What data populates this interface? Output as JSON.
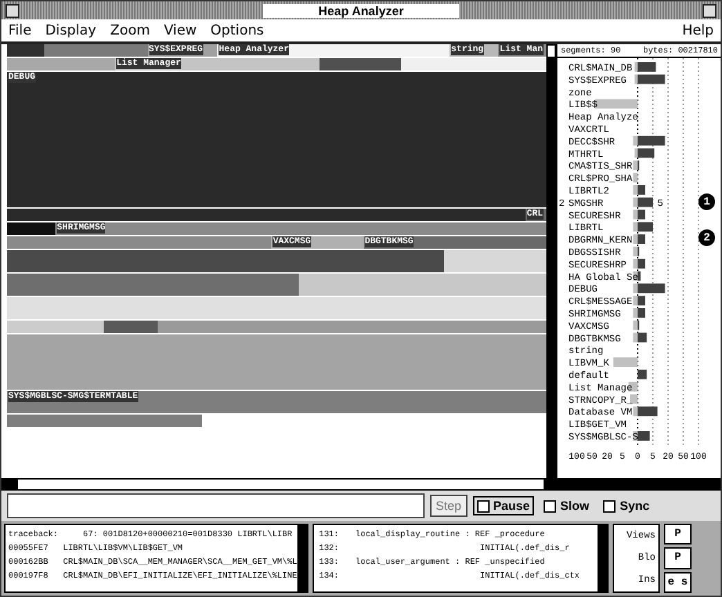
{
  "window": {
    "title": "Heap Analyzer"
  },
  "menu": {
    "left": [
      "File",
      "Display",
      "Zoom",
      "View",
      "Options"
    ],
    "right": "Help"
  },
  "memory_map": {
    "rows": [
      {
        "kind": "thin",
        "segments": [
          {
            "color": "#303030"
          },
          {
            "color": "#7a7a7a"
          },
          {
            "label": "SYS$EXPREG",
            "color": "#a0a0a0"
          },
          {
            "label": "Heap Analyzer",
            "color": "#f4f4f4"
          },
          {
            "label": "string",
            "color": "#b8b8b8"
          },
          {
            "label": "List Man",
            "color": "#8a8a8a"
          }
        ]
      },
      {
        "kind": "thin",
        "segments": [
          {
            "color": "#a8a8a8"
          },
          {
            "label": "List Manager",
            "color": "#c4c4c4"
          },
          {
            "color": "#505050"
          },
          {
            "color": "#f0f0f0"
          }
        ]
      },
      {
        "kind": "huge",
        "segments": [
          {
            "label": "DEBUG",
            "color": "#2a2a2a"
          }
        ]
      },
      {
        "kind": "thin",
        "segments": [
          {
            "color": "#2a2a2a"
          },
          {
            "label": "CRL",
            "color": "#6a6a6a"
          }
        ]
      },
      {
        "kind": "thin",
        "segments": [
          {
            "color": "#101010"
          },
          {
            "label": "SHRIMGMSG",
            "color": "#8a8a8a"
          }
        ]
      },
      {
        "kind": "thin",
        "segments": [
          {
            "color": "#8a8a8a"
          },
          {
            "label": "VAXCMSG",
            "color": "#b0b0b0"
          },
          {
            "label": "DBGTBKMSG",
            "color": "#6a6a6a"
          }
        ]
      },
      {
        "kind": "mid",
        "segments": [
          {
            "color": "#4a4a4a"
          },
          {
            "color": "#d8d8d8"
          }
        ]
      },
      {
        "kind": "mid",
        "segments": [
          {
            "color": "#6e6e6e"
          },
          {
            "color": "#c8c8c8"
          }
        ]
      },
      {
        "kind": "mid",
        "segments": [
          {
            "color": "#e0e0e0"
          }
        ]
      },
      {
        "kind": "thin",
        "segments": [
          {
            "color": "#cccccc"
          },
          {
            "color": "#5a5a5a"
          },
          {
            "color": "#9a9a9a"
          }
        ]
      },
      {
        "kind": "big",
        "segments": [
          {
            "color": "#a4a4a4"
          }
        ]
      },
      {
        "kind": "mid",
        "segments": [
          {
            "label": "SYS$MGBLSC-SMG$TERMTABLE",
            "color": "#7e7e7e"
          }
        ]
      },
      {
        "kind": "thin",
        "segments": [
          {
            "color": "#7e7e7e"
          },
          {
            "color": "#ffffff"
          }
        ]
      }
    ]
  },
  "segments_panel": {
    "segments": "segments: 90",
    "bytes": "bytes: 00217810",
    "callouts": [
      "1",
      "2"
    ],
    "items": [
      {
        "name": "CRL$MAIN_DB"
      },
      {
        "name": "SYS$EXPREG"
      },
      {
        "name": "zone"
      },
      {
        "name": "LIB$$"
      },
      {
        "name": "Heap Analyze"
      },
      {
        "name": "VAXCRTL"
      },
      {
        "name": "DECC$SHR"
      },
      {
        "name": "MTHRTL"
      },
      {
        "name": "CMA$TIS_SHR"
      },
      {
        "name": "CRL$PRO_SHA"
      },
      {
        "name": "LIBRTL2"
      },
      {
        "name": "SMGSHR",
        "left_mark": "2",
        "right_mark": "5"
      },
      {
        "name": "SECURESHR"
      },
      {
        "name": "LIBRTL"
      },
      {
        "name": "DBGRMN_KERN"
      },
      {
        "name": "DBGSSISHR"
      },
      {
        "name": "SECURESHRP"
      },
      {
        "name": "HA Global Se"
      },
      {
        "name": "DEBUG"
      },
      {
        "name": "CRL$MESSAGE"
      },
      {
        "name": "SHRIMGMSG"
      },
      {
        "name": "VAXCMSG"
      },
      {
        "name": "DBGTBKMSG"
      },
      {
        "name": "string"
      },
      {
        "name": "LIBVM_K"
      },
      {
        "name": "default"
      },
      {
        "name": "List Manage"
      },
      {
        "name": "STRNCOPY_R_"
      },
      {
        "name": "Database VM"
      },
      {
        "name": "LIB$GET_VM"
      },
      {
        "name": "SYS$MGBLSC-S"
      }
    ],
    "axis_labels": [
      "100",
      "50",
      "20",
      "5",
      "0",
      "5",
      "20",
      "50",
      "100"
    ]
  },
  "controls": {
    "step": "Step",
    "step_disabled": true,
    "checks": [
      {
        "label": "Pause",
        "checked": false,
        "selected": true
      },
      {
        "label": "Slow",
        "checked": false,
        "selected": false
      },
      {
        "label": "Sync",
        "checked": false,
        "selected": false
      }
    ]
  },
  "traceback": [
    "traceback:     67: 001D8120+00000210=001D8330 LIBRTL\\LIBR",
    "00055FE7   LIBRTL\\LIB$VM\\LIB$GET_VM",
    "000162BB   CRL$MAIN_DB\\SCA__MEM_MANAGER\\SCA__MEM_GET_VM\\%L",
    "000197F8   CRL$MAIN_DB\\EFI_INITIALIZE\\EFI_INITIALIZE\\%LINE"
  ],
  "source": [
    {
      "line": "131:",
      "code": "local_display_routine : REF _procedure"
    },
    {
      "line": "132:",
      "code": "                         INITIAL(.def_dis_r"
    },
    {
      "line": "133:",
      "code": "local_user_argument : REF _unspecified"
    },
    {
      "line": "134:",
      "code": "                         INITIAL(.def_dis_ctx"
    }
  ],
  "views": {
    "labels": [
      "Views",
      "Blo",
      "Ins"
    ],
    "side_buttons": [
      "P",
      "P",
      "e s"
    ]
  }
}
